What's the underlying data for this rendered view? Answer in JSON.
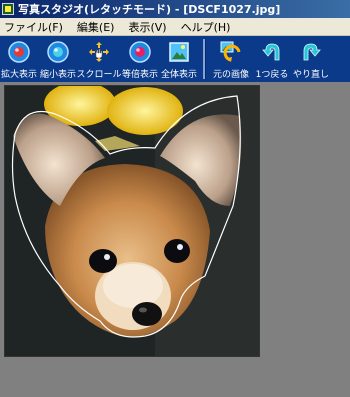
{
  "window": {
    "title": "写真スタジオ(レタッチモード) - [DSCF1027.jpg]"
  },
  "menu": {
    "items": [
      "ファイル(F)",
      "編集(E)",
      "表示(V)",
      "ヘルプ(H)"
    ]
  },
  "toolbar": {
    "buttons": [
      {
        "label": "拡大表示",
        "icon": "zoom-in-icon"
      },
      {
        "label": "縮小表示",
        "icon": "zoom-out-icon"
      },
      {
        "label": "スクロール",
        "icon": "hand-icon"
      },
      {
        "label": "等倍表示",
        "icon": "actual-size-icon"
      },
      {
        "label": "全体表示",
        "icon": "fit-window-icon"
      },
      {
        "label": "元の画像",
        "icon": "original-image-icon"
      },
      {
        "label": "1つ戻る",
        "icon": "undo-icon"
      },
      {
        "label": "やり直し",
        "icon": "redo-icon"
      }
    ]
  },
  "colors": {
    "toolbar_bg": "#0b3a8a",
    "canvas_bg": "#808080",
    "title_gradient_start": "#0a246a",
    "title_gradient_end": "#3a6ea5"
  }
}
